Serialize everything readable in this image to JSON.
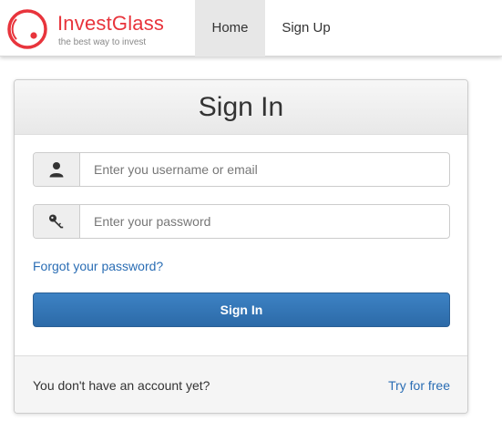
{
  "brand": {
    "name": "InvestGlass",
    "tagline": "the best way to invest",
    "logo_icon": "red-ring-logo",
    "color": "#e8343c"
  },
  "nav": {
    "tabs": [
      {
        "label": "Home",
        "active": true
      },
      {
        "label": "Sign Up",
        "active": false
      }
    ]
  },
  "signin": {
    "title": "Sign In",
    "username": {
      "icon": "user-icon",
      "placeholder": "Enter you username or email",
      "value": ""
    },
    "password": {
      "icon": "key-icon",
      "placeholder": "Enter your password",
      "value": ""
    },
    "forgot_label": "Forgot your password?",
    "button_label": "Sign In",
    "button_color": "#337ab7",
    "link_color": "#2a6db4"
  },
  "footer": {
    "text": "You don't have an account yet?",
    "link_label": "Try for free"
  }
}
